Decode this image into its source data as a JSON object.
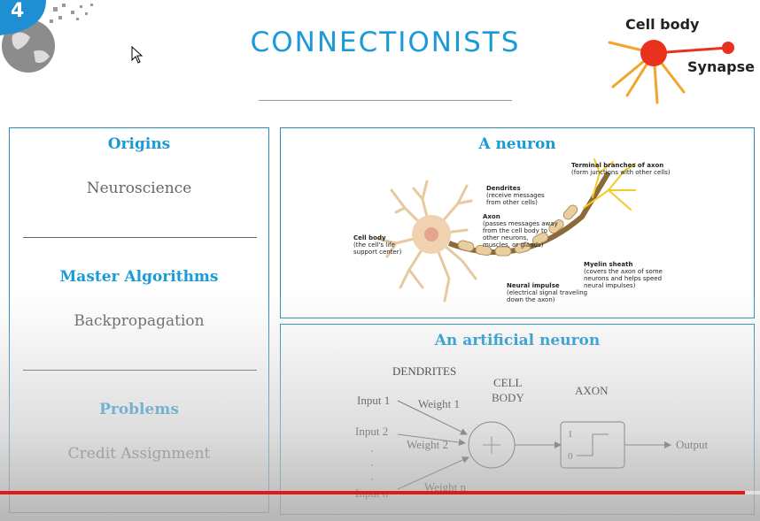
{
  "slide": {
    "number": "4",
    "title": "CONNECTIONISTS"
  },
  "corner_logo": {
    "cell_body_label": "Cell body",
    "synapse_label": "Synapse"
  },
  "left_panel": {
    "sections": [
      {
        "heading": "Origins",
        "text": "Neuroscience"
      },
      {
        "heading": "Master Algorithms",
        "text": "Backpropagation"
      },
      {
        "heading": "Problems",
        "text": "Credit Assignment"
      }
    ]
  },
  "neuron_panel": {
    "title": "A neuron",
    "annotations": {
      "terminal_title": "Terminal branches of axon",
      "terminal_sub": "(form junctions with other cells)",
      "dendrites_title": "Dendrites",
      "dendrites_sub1": "(receive messages",
      "dendrites_sub2": "from other cells)",
      "axon_title": "Axon",
      "axon_sub1": "(passes messages away",
      "axon_sub2": "from the cell body to",
      "axon_sub3": "other neurons,",
      "axon_sub4": "muscles, or glands)",
      "cellbody_title": "Cell body",
      "cellbody_sub1": "(the cell's life",
      "cellbody_sub2": "support center)",
      "myelin_title": "Myelin sheath",
      "myelin_sub1": "(covers the axon of some",
      "myelin_sub2": "neurons and helps speed",
      "myelin_sub3": "neural impulses)",
      "impulse_title": "Neural impulse",
      "impulse_sub1": "(electrical signal traveling",
      "impulse_sub2": "down the axon)"
    }
  },
  "artificial_panel": {
    "title": "An artificial neuron",
    "dendrites": "DENDRITES",
    "cell": "CELL",
    "body": "BODY",
    "axon": "AXON",
    "input1": "Input 1",
    "input2": "Input 2",
    "inputn": "Input n",
    "weight1": "Weight 1",
    "weight2": "Weight 2",
    "weightn": "Weight n",
    "output": "Output",
    "step_high": "1",
    "step_low": "0",
    "dots": "·"
  },
  "video": {
    "progress": 0.98
  },
  "colors": {
    "accent": "#1a9ad6",
    "border": "#2a8bbf",
    "progress": "#e01818",
    "logo_red": "#e8321e"
  }
}
